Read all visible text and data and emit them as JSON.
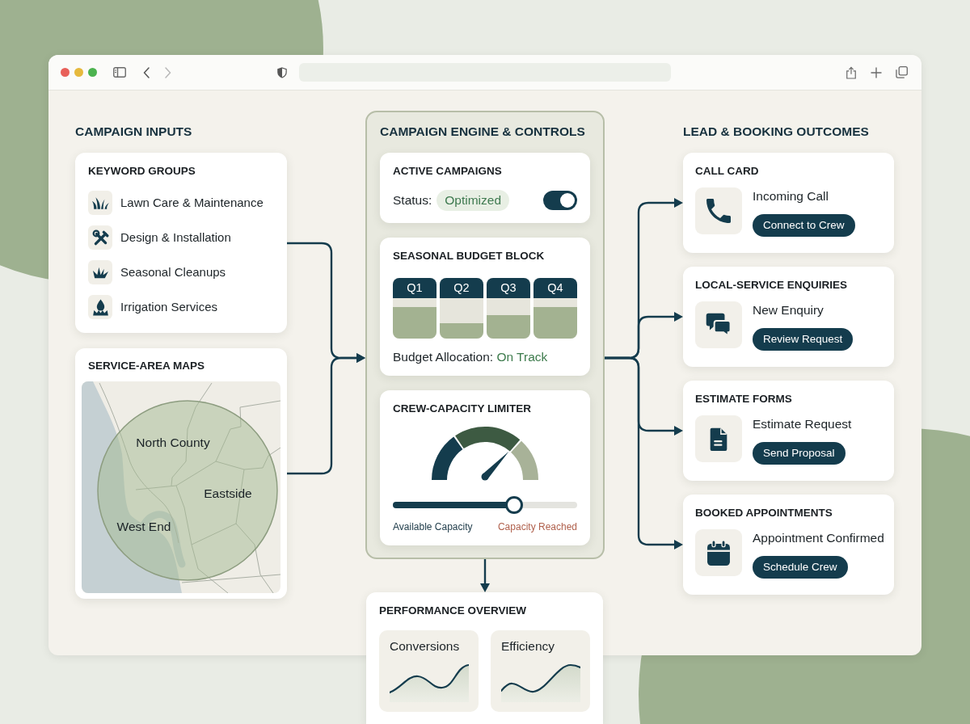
{
  "browser": {
    "forward": {
      "disabled": true
    }
  },
  "inputs": {
    "heading": "CAMPAIGN INPUTS",
    "keyword_groups": {
      "title": "KEYWORD GROUPS",
      "items": [
        {
          "kind": "lawn",
          "label": "Lawn Care & Maintenance"
        },
        {
          "kind": "design",
          "label": "Design & Installation"
        },
        {
          "kind": "cleanup",
          "label": "Seasonal Cleanups"
        },
        {
          "kind": "irrigation",
          "label": "Irrigation Services"
        }
      ]
    },
    "service_area_map": {
      "title": "SERVICE-AREA MAPS",
      "areas": [
        {
          "label": "North County"
        },
        {
          "label": "Eastside"
        },
        {
          "label": "West End"
        }
      ]
    }
  },
  "engine": {
    "heading": "CAMPAIGN ENGINE & CONTROLS",
    "active_campaigns": {
      "title": "ACTIVE CAMPAIGNS",
      "status_label": "Status:",
      "status": "Optimized",
      "on": true
    },
    "seasonal_budget": {
      "title": "SEASONAL BUDGET BLOCK",
      "quarters": [
        {
          "label": "Q1",
          "level": 0.52
        },
        {
          "label": "Q2",
          "level": 0.25
        },
        {
          "label": "Q3",
          "level": 0.39
        },
        {
          "label": "Q4",
          "level": 0.52
        }
      ],
      "allocation_label": "Budget Allocation:",
      "allocation_status": "On Track"
    },
    "crew_capacity": {
      "title": "CREW-CAPACITY LIMITER",
      "gauge": {
        "level": 0.74
      },
      "slider": {
        "level": 0.66
      },
      "min_label": "Available Capacity",
      "max_label": "Capacity Reached"
    }
  },
  "outcomes": {
    "heading": "LEAD & BOOKING OUTCOMES",
    "cards": [
      {
        "kind": "call",
        "title": "CALL CARD",
        "label": "Incoming Call",
        "action": "Connect to Crew"
      },
      {
        "kind": "enquiry",
        "title": "LOCAL-SERVICE ENQUIRIES",
        "label": "New Enquiry",
        "action": "Review Request"
      },
      {
        "kind": "estimate",
        "title": "ESTIMATE FORMS",
        "label": "Estimate Request",
        "action": "Send Proposal"
      },
      {
        "kind": "appointment",
        "title": "BOOKED APPOINTMENTS",
        "label": "Appointment Confirmed",
        "action": "Schedule Crew"
      }
    ]
  },
  "performance": {
    "title": "PERFORMANCE OVERVIEW",
    "metrics": [
      {
        "label": "Conversions"
      },
      {
        "label": "Efficiency"
      }
    ]
  }
}
